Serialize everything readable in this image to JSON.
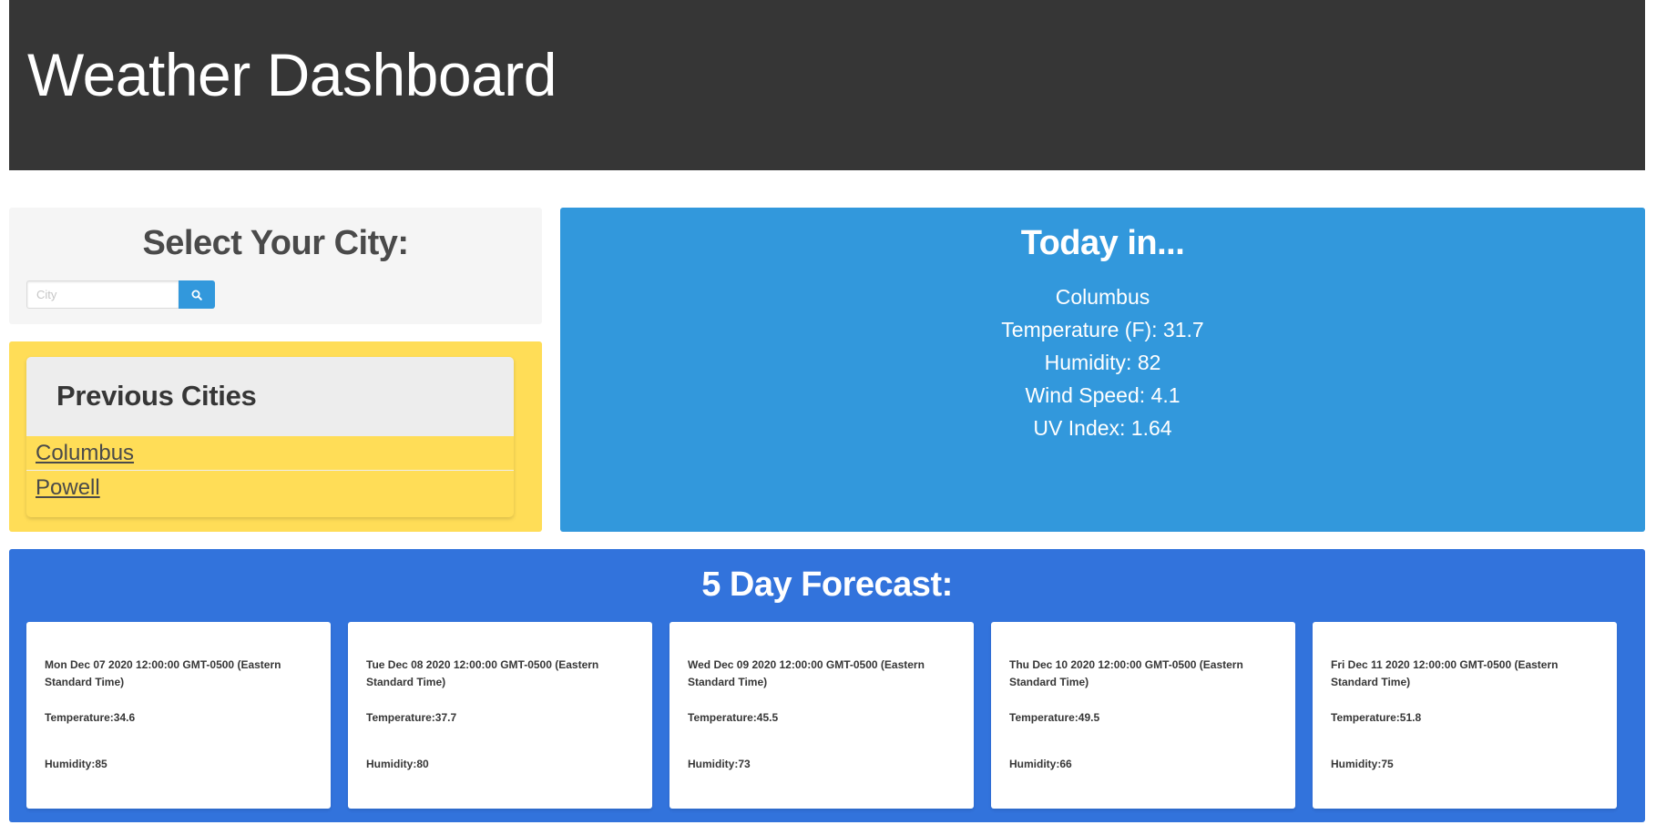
{
  "header": {
    "title": "Weather Dashboard"
  },
  "search": {
    "heading": "Select Your City:",
    "placeholder": "City",
    "value": "",
    "button_icon": "search-icon"
  },
  "previous": {
    "heading": "Previous Cities",
    "cities": [
      "Columbus",
      "Powell"
    ]
  },
  "today": {
    "heading": "Today in...",
    "city": "Columbus",
    "temperature": "Temperature (F): 31.7",
    "humidity": "Humidity: 82",
    "wind": "Wind Speed: 4.1",
    "uv": "UV Index: 1.64"
  },
  "forecast": {
    "heading": "5 Day Forecast:",
    "days": [
      {
        "date": "Mon Dec 07 2020 12:00:00 GMT-0500 (Eastern Standard Time)",
        "temperature": "Temperature:34.6",
        "humidity": "Humidity:85"
      },
      {
        "date": "Tue Dec 08 2020 12:00:00 GMT-0500 (Eastern Standard Time)",
        "temperature": "Temperature:37.7",
        "humidity": "Humidity:80"
      },
      {
        "date": "Wed Dec 09 2020 12:00:00 GMT-0500 (Eastern Standard Time)",
        "temperature": "Temperature:45.5",
        "humidity": "Humidity:73"
      },
      {
        "date": "Thu Dec 10 2020 12:00:00 GMT-0500 (Eastern Standard Time)",
        "temperature": "Temperature:49.5",
        "humidity": "Humidity:66"
      },
      {
        "date": "Fri Dec 11 2020 12:00:00 GMT-0500 (Eastern Standard Time)",
        "temperature": "Temperature:51.8",
        "humidity": "Humidity:75"
      }
    ]
  },
  "colors": {
    "header_bg": "#363636",
    "search_panel_bg": "#f5f5f5",
    "previous_panel_bg": "#ffdd57",
    "today_panel_bg": "#3298dc",
    "forecast_panel_bg": "#3273dc",
    "search_button_bg": "#3298dc"
  }
}
